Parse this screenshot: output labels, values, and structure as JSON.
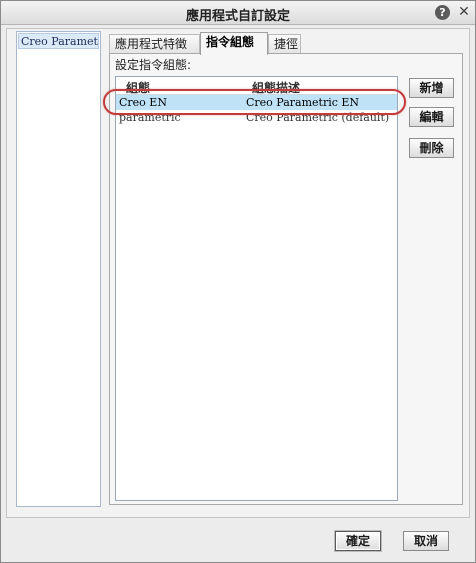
{
  "window": {
    "title": "應用程式自訂設定",
    "help_glyph": "?",
    "close_glyph": "✕"
  },
  "left_list": {
    "items": [
      {
        "label": "Creo Parametric"
      }
    ]
  },
  "tabs": [
    {
      "label": "應用程式特徵",
      "active": false
    },
    {
      "label": "指令組態",
      "active": true
    },
    {
      "label": "捷徑",
      "active": false
    }
  ],
  "panel": {
    "section_label": "設定指令組態:",
    "table": {
      "columns": [
        "組態",
        "組態描述"
      ],
      "rows": [
        {
          "name": "Creo EN",
          "description": "Creo Parametric EN",
          "selected": true
        },
        {
          "name": "parametric",
          "description": "Creo Parametric (default)",
          "selected": false
        }
      ]
    },
    "buttons": {
      "new_label": "新增",
      "edit_label": "編輯",
      "delete_label": "刪除"
    }
  },
  "footer": {
    "ok_label": "確定",
    "cancel_label": "取消"
  },
  "colors": {
    "selection": "#bfe2f6",
    "highlight_oval": "#c43b3b"
  }
}
